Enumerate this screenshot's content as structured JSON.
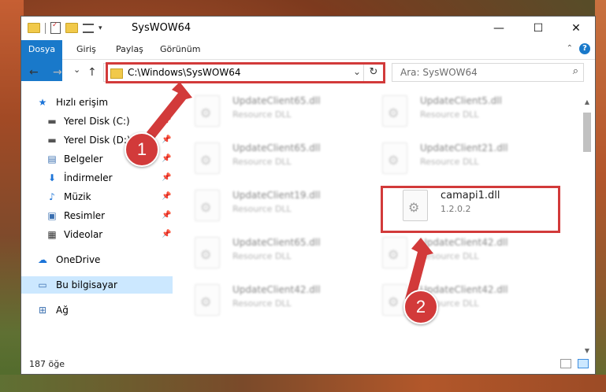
{
  "window": {
    "title": "SysWOW64",
    "controls": {
      "minimize": "—",
      "maximize": "☐",
      "close": "✕"
    }
  },
  "ribbon": {
    "tabs": [
      "Dosya",
      "Giriş",
      "Paylaş",
      "Görünüm"
    ],
    "help": "?"
  },
  "navigation": {
    "back": "←",
    "forward": "→",
    "recent": "⌄",
    "up": "↑",
    "address": "C:\\Windows\\SysWOW64",
    "search_placeholder": "Ara: SysWOW64"
  },
  "sidebar": {
    "items": [
      {
        "label": "Hızlı erişim",
        "icon": "star-icon"
      },
      {
        "label": "Yerel Disk (C:)",
        "icon": "drive-icon",
        "pinned": true
      },
      {
        "label": "Yerel Disk (D:)",
        "icon": "drive-icon",
        "pinned": true
      },
      {
        "label": "Belgeler",
        "icon": "documents-icon",
        "pinned": true
      },
      {
        "label": "İndirmeler",
        "icon": "download-icon",
        "pinned": true
      },
      {
        "label": "Müzik",
        "icon": "music-icon",
        "pinned": true
      },
      {
        "label": "Resimler",
        "icon": "pictures-icon",
        "pinned": true
      },
      {
        "label": "Videolar",
        "icon": "videos-icon",
        "pinned": true
      },
      {
        "label": "OneDrive",
        "icon": "cloud-icon"
      },
      {
        "label": "Bu bilgisayar",
        "icon": "computer-icon",
        "selected": true
      },
      {
        "label": "Ağ",
        "icon": "network-icon"
      }
    ]
  },
  "files": [
    {
      "name": "UpdateClient65.dll",
      "type": "Resource DLL"
    },
    {
      "name": "UpdateClient5.dll",
      "type": "Resource DLL"
    },
    {
      "name": "UpdateClient65.dll",
      "type": "Resource DLL"
    },
    {
      "name": "UpdateClient21.dll",
      "type": "Resource DLL"
    },
    {
      "name": "UpdateClient19.dll",
      "type": "Resource DLL"
    },
    {
      "name": "camapi1.dll",
      "type": "1.2.0.2"
    },
    {
      "name": "UpdateClient65.dll",
      "type": "Resource DLL"
    },
    {
      "name": "UpdateClient42.dll",
      "type": "Resource DLL"
    },
    {
      "name": "UpdateClient42.dll",
      "type": "Resource DLL"
    },
    {
      "name": "UpdateClient42.dll",
      "type": "Resource DLL"
    }
  ],
  "status": {
    "count": "187 öğe"
  },
  "annotations": {
    "step1": "1",
    "step2": "2",
    "color": "#d23a3a"
  }
}
